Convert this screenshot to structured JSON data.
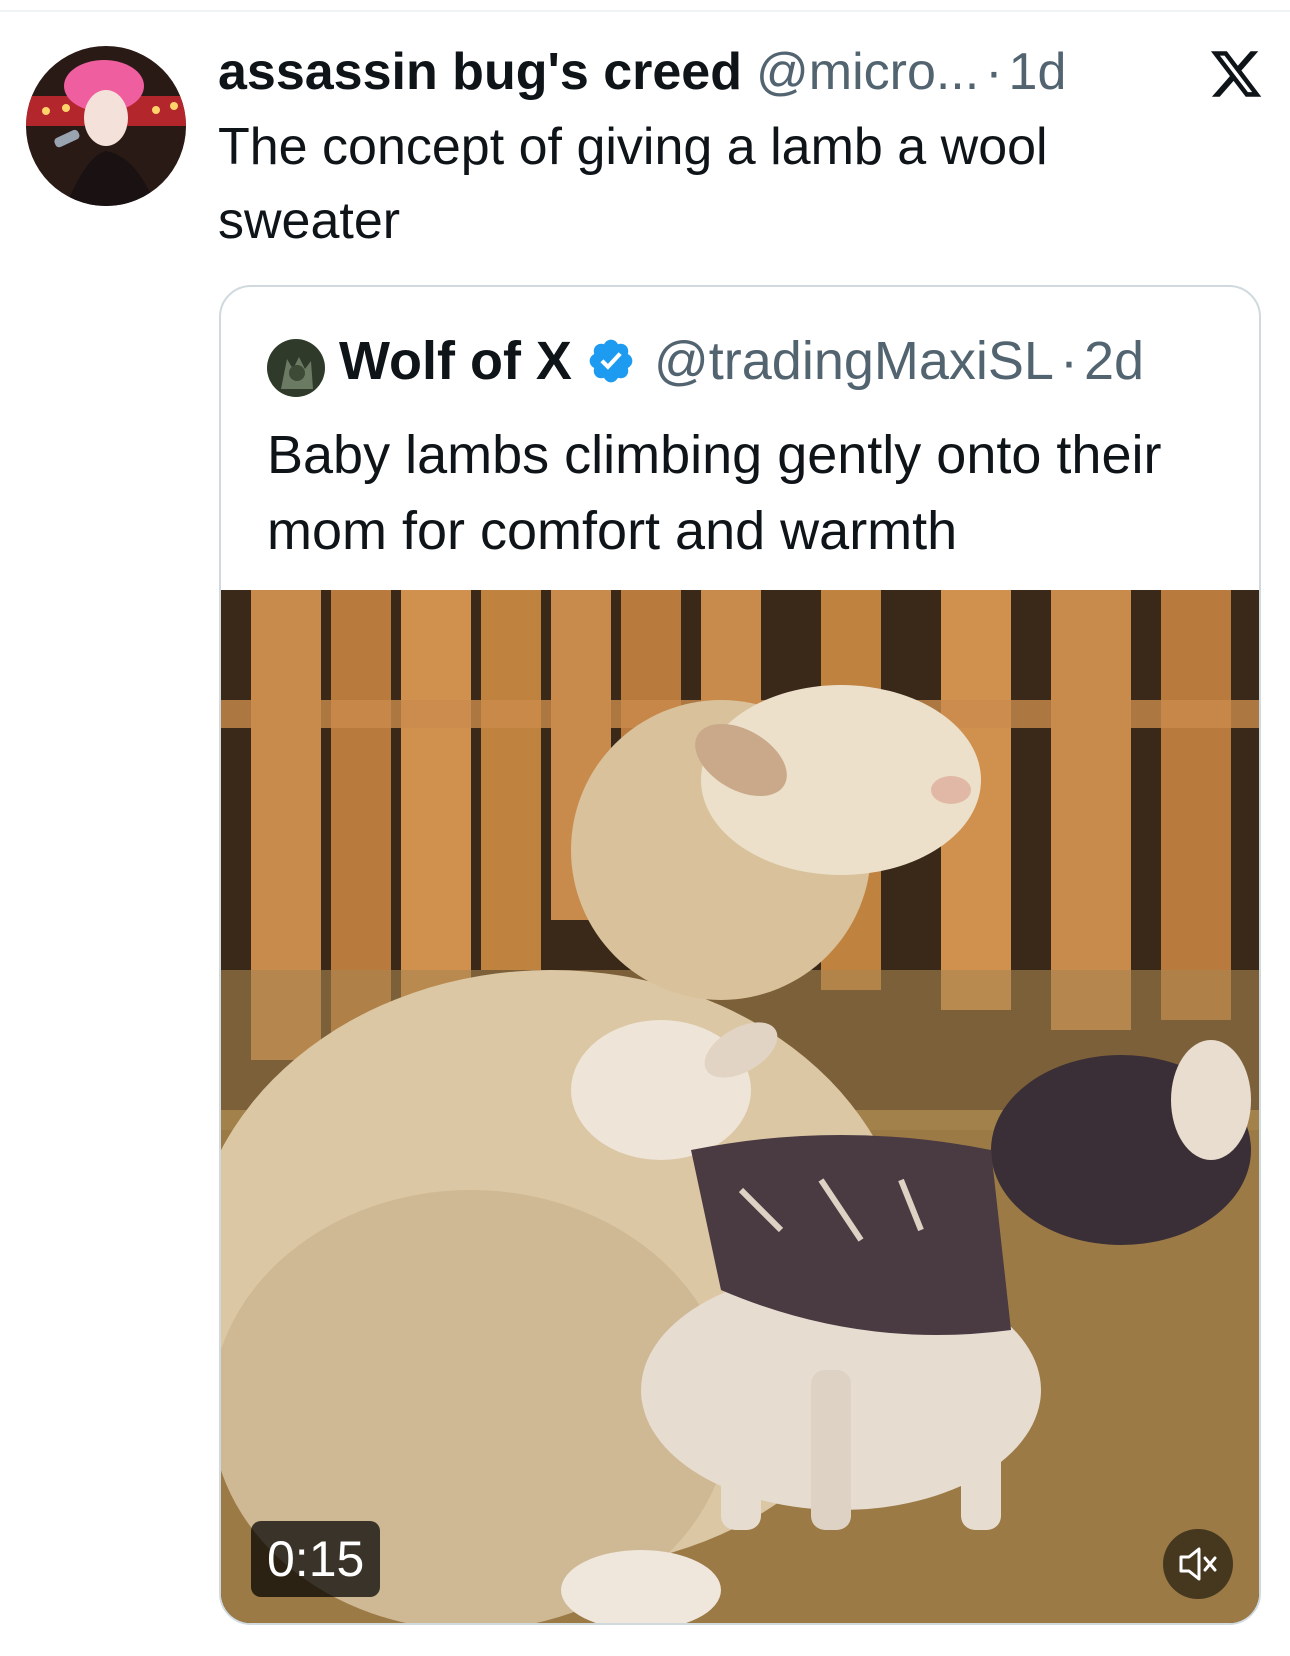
{
  "tweet": {
    "display_name": "assassin bug's creed",
    "handle": "@micro...",
    "separator": "·",
    "age": "1d",
    "text": "The concept of giving a lamb a wool sweater",
    "avatar_icon": "avatar-photo"
  },
  "quoted": {
    "display_name": "Wolf of X",
    "handle": "@tradingMaxiSL",
    "separator": "·",
    "age": "2d",
    "verified_color": "#1d9bf0",
    "text": "Baby lambs climbing gently onto their mom for comfort and warmth",
    "video": {
      "duration": "0:15",
      "muted": true
    }
  },
  "brand": {
    "logo_icon": "x-logo-icon"
  }
}
